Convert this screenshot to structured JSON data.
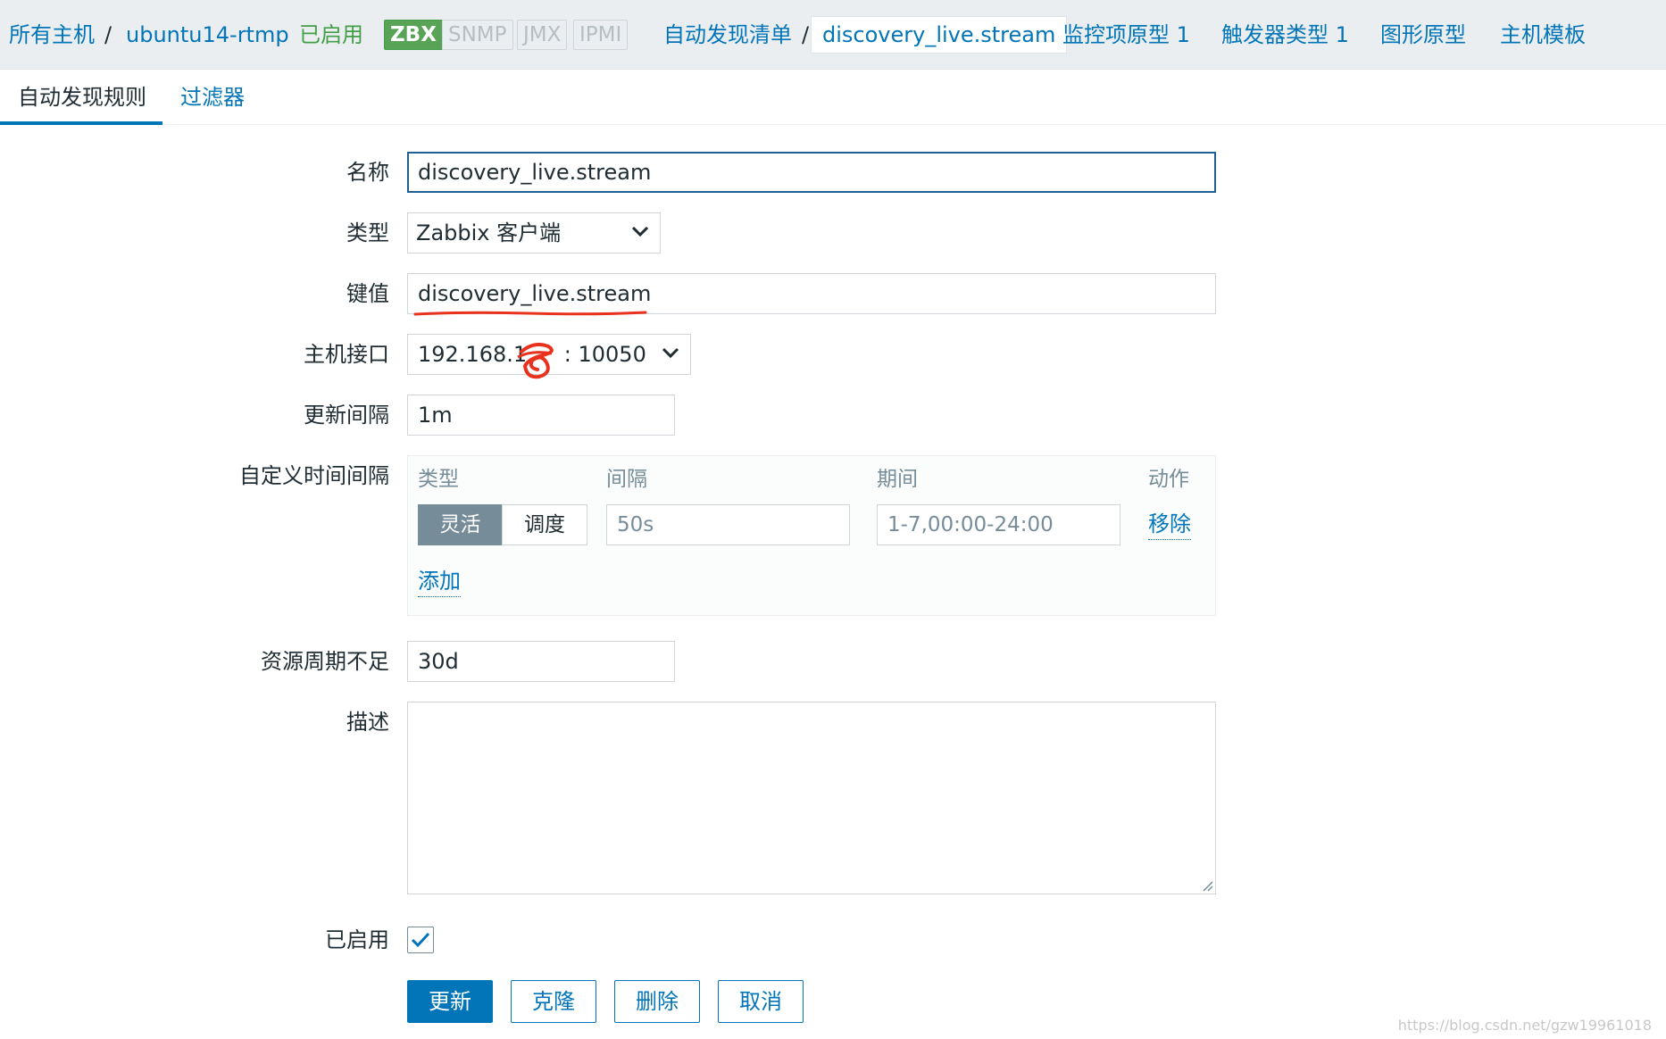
{
  "breadcrumb": {
    "all_hosts": "所有主机",
    "separator": "/",
    "host": "ubuntu14-rtmp",
    "status": "已启用",
    "availability": [
      "ZBX",
      "SNMP",
      "JMX",
      "IPMI"
    ],
    "discovery_list": "自动发现清单",
    "current": "discovery_live.stream",
    "item_prototypes": "监控项原型 1",
    "trigger_prototypes": "触发器类型 1",
    "graph_prototypes": "图形原型",
    "host_prototypes": "主机模板"
  },
  "tabs": {
    "discovery_rule": "自动发现规则",
    "filters": "过滤器"
  },
  "form": {
    "name": {
      "label": "名称",
      "value": "discovery_live.stream"
    },
    "type": {
      "label": "类型",
      "value": "Zabbix 客户端"
    },
    "key": {
      "label": "键值",
      "value": "discovery_live.stream"
    },
    "interface": {
      "label": "主机接口",
      "value_prefix": "192.168.1.",
      "value_suffix": ": 10050"
    },
    "update_interval": {
      "label": "更新间隔",
      "value": "1m"
    },
    "custom_intervals": {
      "label": "自定义时间间隔",
      "col_type": "类型",
      "col_interval": "间隔",
      "col_period": "期间",
      "col_action": "动作",
      "type_flexible": "灵活",
      "type_scheduling": "调度",
      "interval_placeholder": "50s",
      "period_placeholder": "1-7,00:00-24:00",
      "remove": "移除",
      "add": "添加"
    },
    "lifetime": {
      "label": "资源周期不足",
      "value": "30d"
    },
    "description": {
      "label": "描述",
      "value": ""
    },
    "enabled": {
      "label": "已启用",
      "checked": true
    }
  },
  "buttons": {
    "update": "更新",
    "clone": "克隆",
    "delete": "删除",
    "cancel": "取消"
  },
  "watermark": "https://blog.csdn.net/gzw19961018",
  "colors": {
    "link": "#0275b8",
    "enabled_green": "#429e47",
    "zbx_badge": "#59a356",
    "primary_button": "#0275b8",
    "annotation_red": "#e8321d"
  }
}
